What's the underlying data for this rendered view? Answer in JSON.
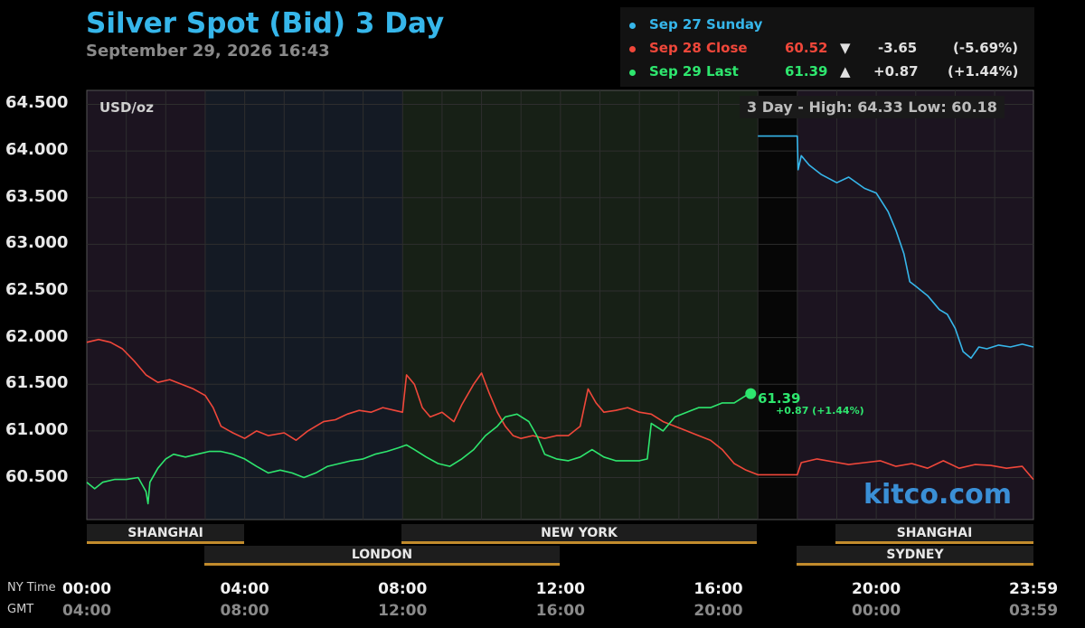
{
  "header": {
    "title": "Silver Spot (Bid) 3 Day",
    "subtitle": "September 29, 2026 16:43"
  },
  "legend": {
    "rows": [
      {
        "label": "Sep 27 Sunday",
        "color": "#36b6ea",
        "value": "",
        "arrow": "",
        "change": "",
        "pct": ""
      },
      {
        "label": "Sep 28 Close",
        "color": "#f0473a",
        "value": "60.52",
        "arrow": "▼",
        "change": "-3.65",
        "pct": "(-5.69%)"
      },
      {
        "label": "Sep 29 Last",
        "color": "#2ee66e",
        "value": "61.39",
        "arrow": "▲",
        "change": "+0.87",
        "pct": "(+1.44%)"
      }
    ]
  },
  "chart_labels": {
    "unit": "USD/oz",
    "hilo": "3 Day - High: 64.33  Low: 60.18",
    "brand": "kitco.com",
    "last_value": "61.39",
    "last_change": "+0.87 (+1.44%)",
    "ny_time_label": "NY Time",
    "gmt_label": "GMT"
  },
  "sessions": [
    {
      "name": "SHANGHAI"
    },
    {
      "name": "NEW YORK"
    },
    {
      "name": "SHANGHAI"
    },
    {
      "name": "LONDON"
    },
    {
      "name": "SYDNEY"
    }
  ],
  "chart_data": {
    "type": "line",
    "ylim": [
      60.05,
      64.65
    ],
    "xlim": [
      0,
      23.983
    ],
    "yticks": [
      "64.500",
      "64.000",
      "63.500",
      "63.000",
      "62.500",
      "62.000",
      "61.500",
      "61.000",
      "60.500"
    ],
    "ytick_values": [
      64.5,
      64.0,
      63.5,
      63.0,
      62.5,
      62.0,
      61.5,
      61.0,
      60.5
    ],
    "xticks_ny": [
      "00:00",
      "04:00",
      "08:00",
      "12:00",
      "16:00",
      "20:00",
      "23:59"
    ],
    "xticks_gmt": [
      "04:00",
      "08:00",
      "12:00",
      "16:00",
      "20:00",
      "00:00",
      "03:59"
    ],
    "xtick_values": [
      0,
      4,
      8,
      12,
      16,
      20,
      23.983
    ],
    "series": [
      {
        "name": "Sep 27 Sunday",
        "color": "#36b6ea",
        "points": [
          [
            17,
            64.16
          ],
          [
            18,
            64.16
          ],
          [
            18.02,
            63.8
          ],
          [
            18.1,
            63.95
          ],
          [
            18.3,
            63.85
          ],
          [
            18.6,
            63.75
          ],
          [
            19,
            63.66
          ],
          [
            19.3,
            63.72
          ],
          [
            19.7,
            63.6
          ],
          [
            20,
            63.55
          ],
          [
            20.3,
            63.35
          ],
          [
            20.5,
            63.15
          ],
          [
            20.7,
            62.9
          ],
          [
            20.85,
            62.6
          ],
          [
            21.0,
            62.55
          ],
          [
            21.3,
            62.45
          ],
          [
            21.6,
            62.3
          ],
          [
            21.8,
            62.25
          ],
          [
            22.0,
            62.1
          ],
          [
            22.2,
            61.85
          ],
          [
            22.4,
            61.78
          ],
          [
            22.6,
            61.9
          ],
          [
            22.8,
            61.88
          ],
          [
            23.1,
            61.92
          ],
          [
            23.4,
            61.9
          ],
          [
            23.7,
            61.93
          ],
          [
            23.98,
            61.9
          ]
        ]
      },
      {
        "name": "Sep 28 Close",
        "color": "#f0473a",
        "points": [
          [
            0,
            61.95
          ],
          [
            0.3,
            61.98
          ],
          [
            0.6,
            61.95
          ],
          [
            0.9,
            61.88
          ],
          [
            1.2,
            61.75
          ],
          [
            1.5,
            61.6
          ],
          [
            1.8,
            61.52
          ],
          [
            2.1,
            61.55
          ],
          [
            2.4,
            61.5
          ],
          [
            2.7,
            61.45
          ],
          [
            3.0,
            61.38
          ],
          [
            3.2,
            61.25
          ],
          [
            3.4,
            61.05
          ],
          [
            3.7,
            60.98
          ],
          [
            4.0,
            60.92
          ],
          [
            4.3,
            61.0
          ],
          [
            4.6,
            60.95
          ],
          [
            5.0,
            60.98
          ],
          [
            5.3,
            60.9
          ],
          [
            5.6,
            61.0
          ],
          [
            6.0,
            61.1
          ],
          [
            6.3,
            61.12
          ],
          [
            6.6,
            61.18
          ],
          [
            6.9,
            61.22
          ],
          [
            7.2,
            61.2
          ],
          [
            7.5,
            61.25
          ],
          [
            7.8,
            61.22
          ],
          [
            8.0,
            61.2
          ],
          [
            8.1,
            61.6
          ],
          [
            8.3,
            61.5
          ],
          [
            8.5,
            61.25
          ],
          [
            8.7,
            61.15
          ],
          [
            9.0,
            61.2
          ],
          [
            9.3,
            61.1
          ],
          [
            9.5,
            61.28
          ],
          [
            9.8,
            61.5
          ],
          [
            10.0,
            61.62
          ],
          [
            10.2,
            61.4
          ],
          [
            10.4,
            61.2
          ],
          [
            10.6,
            61.05
          ],
          [
            10.8,
            60.95
          ],
          [
            11.0,
            60.92
          ],
          [
            11.3,
            60.95
          ],
          [
            11.6,
            60.92
          ],
          [
            11.9,
            60.95
          ],
          [
            12.2,
            60.95
          ],
          [
            12.5,
            61.05
          ],
          [
            12.7,
            61.45
          ],
          [
            12.9,
            61.3
          ],
          [
            13.1,
            61.2
          ],
          [
            13.4,
            61.22
          ],
          [
            13.7,
            61.25
          ],
          [
            14.0,
            61.2
          ],
          [
            14.3,
            61.18
          ],
          [
            14.6,
            61.1
          ],
          [
            14.9,
            61.05
          ],
          [
            15.2,
            61.0
          ],
          [
            15.5,
            60.95
          ],
          [
            15.8,
            60.9
          ],
          [
            16.1,
            60.8
          ],
          [
            16.4,
            60.65
          ],
          [
            16.7,
            60.58
          ],
          [
            17.0,
            60.53
          ],
          [
            17.3,
            60.53
          ],
          [
            17.6,
            60.53
          ],
          [
            18.0,
            60.53
          ],
          [
            18.1,
            60.66
          ],
          [
            18.5,
            60.7
          ],
          [
            18.9,
            60.67
          ],
          [
            19.3,
            60.64
          ],
          [
            19.7,
            60.66
          ],
          [
            20.1,
            60.68
          ],
          [
            20.5,
            60.62
          ],
          [
            20.9,
            60.65
          ],
          [
            21.3,
            60.6
          ],
          [
            21.7,
            60.68
          ],
          [
            22.1,
            60.6
          ],
          [
            22.5,
            60.64
          ],
          [
            22.9,
            60.63
          ],
          [
            23.3,
            60.6
          ],
          [
            23.7,
            60.62
          ],
          [
            23.98,
            60.48
          ]
        ]
      },
      {
        "name": "Sep 29 Last",
        "color": "#2ee66e",
        "points": [
          [
            0,
            60.45
          ],
          [
            0.2,
            60.38
          ],
          [
            0.4,
            60.45
          ],
          [
            0.7,
            60.48
          ],
          [
            1.0,
            60.48
          ],
          [
            1.3,
            60.5
          ],
          [
            1.5,
            60.35
          ],
          [
            1.55,
            60.22
          ],
          [
            1.6,
            60.45
          ],
          [
            1.8,
            60.6
          ],
          [
            2.0,
            60.7
          ],
          [
            2.2,
            60.75
          ],
          [
            2.5,
            60.72
          ],
          [
            2.8,
            60.75
          ],
          [
            3.1,
            60.78
          ],
          [
            3.4,
            60.78
          ],
          [
            3.7,
            60.75
          ],
          [
            4.0,
            60.7
          ],
          [
            4.3,
            60.62
          ],
          [
            4.6,
            60.55
          ],
          [
            4.9,
            60.58
          ],
          [
            5.2,
            60.55
          ],
          [
            5.5,
            60.5
          ],
          [
            5.8,
            60.55
          ],
          [
            6.1,
            60.62
          ],
          [
            6.4,
            60.65
          ],
          [
            6.7,
            60.68
          ],
          [
            7.0,
            60.7
          ],
          [
            7.3,
            60.75
          ],
          [
            7.6,
            60.78
          ],
          [
            7.9,
            60.82
          ],
          [
            8.1,
            60.85
          ],
          [
            8.3,
            60.8
          ],
          [
            8.6,
            60.72
          ],
          [
            8.9,
            60.65
          ],
          [
            9.2,
            60.62
          ],
          [
            9.5,
            60.7
          ],
          [
            9.8,
            60.8
          ],
          [
            10.1,
            60.95
          ],
          [
            10.4,
            61.05
          ],
          [
            10.6,
            61.15
          ],
          [
            10.9,
            61.18
          ],
          [
            11.2,
            61.1
          ],
          [
            11.4,
            60.95
          ],
          [
            11.6,
            60.75
          ],
          [
            11.9,
            60.7
          ],
          [
            12.2,
            60.68
          ],
          [
            12.5,
            60.72
          ],
          [
            12.8,
            60.8
          ],
          [
            13.1,
            60.72
          ],
          [
            13.4,
            60.68
          ],
          [
            13.7,
            60.68
          ],
          [
            14.0,
            60.68
          ],
          [
            14.2,
            60.7
          ],
          [
            14.3,
            61.08
          ],
          [
            14.6,
            61.0
          ],
          [
            14.9,
            61.15
          ],
          [
            15.2,
            61.2
          ],
          [
            15.5,
            61.25
          ],
          [
            15.8,
            61.25
          ],
          [
            16.1,
            61.3
          ],
          [
            16.4,
            61.3
          ],
          [
            16.7,
            61.38
          ],
          [
            16.82,
            61.4
          ]
        ]
      }
    ]
  }
}
